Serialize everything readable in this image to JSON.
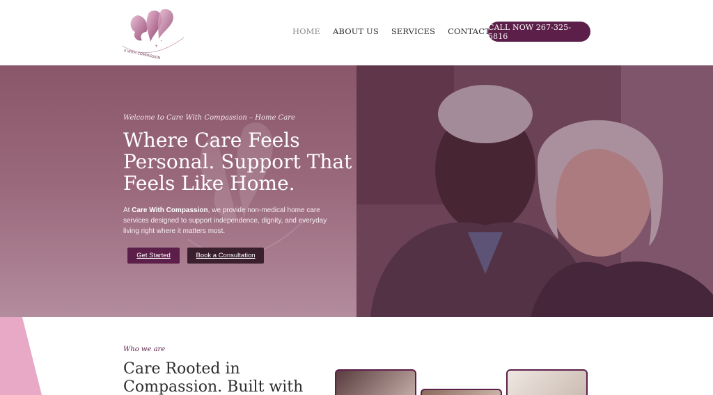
{
  "brand": {
    "logo_text": "CARE WITH COMPASSION",
    "accent_color": "#5c1f49"
  },
  "nav": {
    "items": [
      {
        "label": "HOME",
        "active": true
      },
      {
        "label": "ABOUT US",
        "active": false
      },
      {
        "label": "SERVICES",
        "active": false
      },
      {
        "label": "CONTACT US",
        "active": false
      }
    ],
    "call_label": "CALL NOW 267-325-5816"
  },
  "hero": {
    "eyebrow": "Welcome to Care With Compassion – Home Care",
    "title": "Where Care Feels Personal. Support That Feels Like Home.",
    "desc_prefix": "At ",
    "desc_bold": "Care With Compassion",
    "desc_rest": ", we provide non-medical home care services designed to support independence, dignity, and everyday living right where it matters most.",
    "primary_button": "Get Started",
    "secondary_button": "Book a Consultation"
  },
  "about": {
    "eyebrow": "Who we are",
    "title": "Care Rooted in Compassion. Built with"
  }
}
